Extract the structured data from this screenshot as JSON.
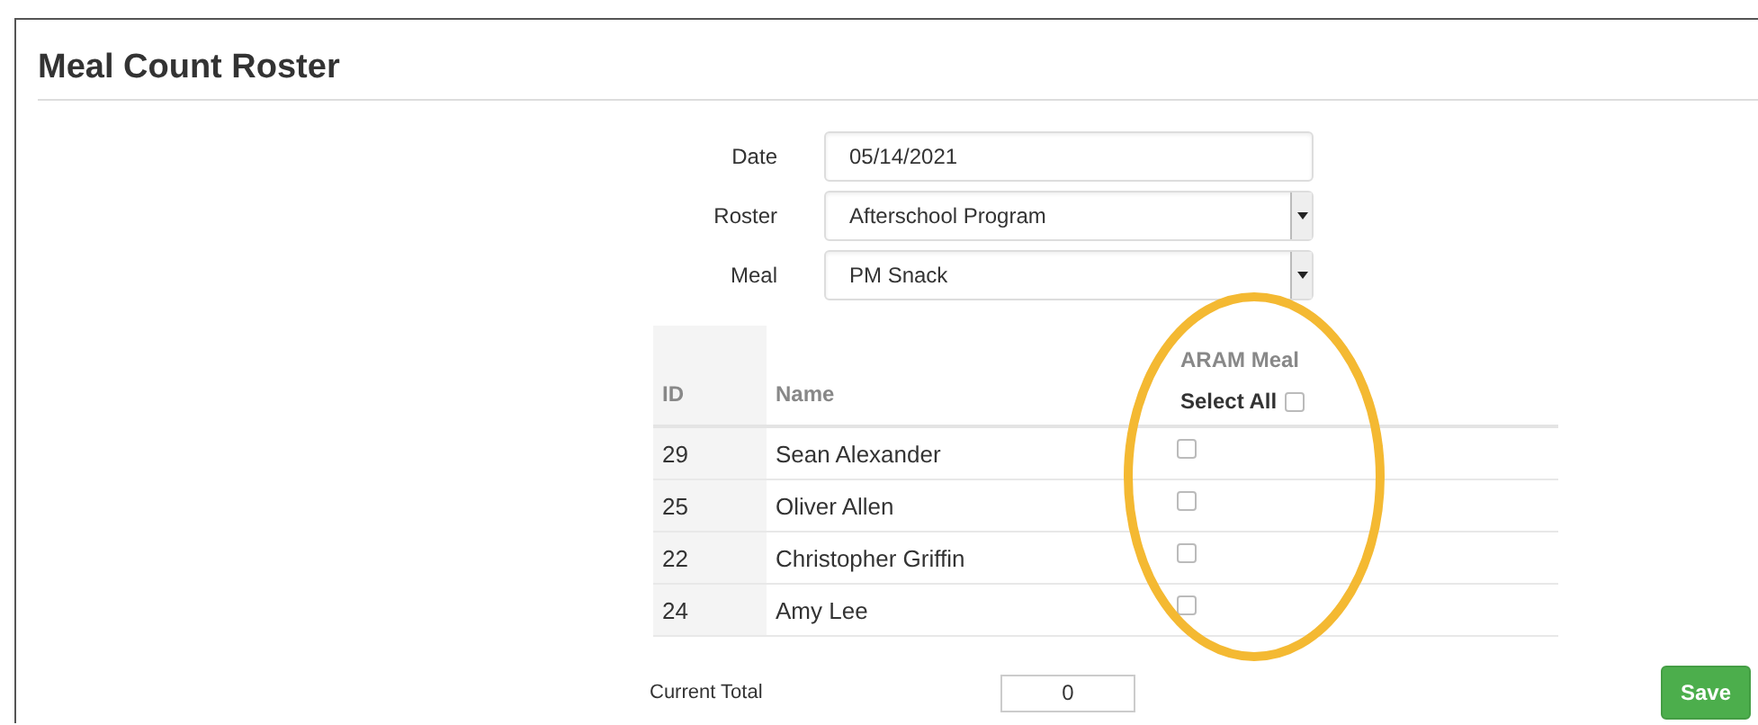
{
  "title": "Meal Count Roster",
  "form": [
    {
      "label": "Date",
      "kind": "text",
      "value": "05/14/2021"
    },
    {
      "label": "Roster",
      "kind": "select",
      "value": "Afterschool Program"
    },
    {
      "label": "Meal",
      "kind": "select",
      "value": "PM Snack"
    }
  ],
  "table": {
    "columns": [
      "ID",
      "Name"
    ],
    "meal_column": {
      "title": "ARAM Meal",
      "select_all": "Select All",
      "checked": false
    },
    "rows": [
      {
        "id": "29",
        "name": "Sean Alexander",
        "checked": false
      },
      {
        "id": "25",
        "name": "Oliver Allen",
        "checked": false
      },
      {
        "id": "22",
        "name": "Christopher Griffin",
        "checked": false
      },
      {
        "id": "24",
        "name": "Amy Lee",
        "checked": false
      }
    ]
  },
  "annotation": {
    "kind": "ellipse"
  },
  "footer": {
    "label": "Current Total",
    "value": "0",
    "button": "Save"
  }
}
